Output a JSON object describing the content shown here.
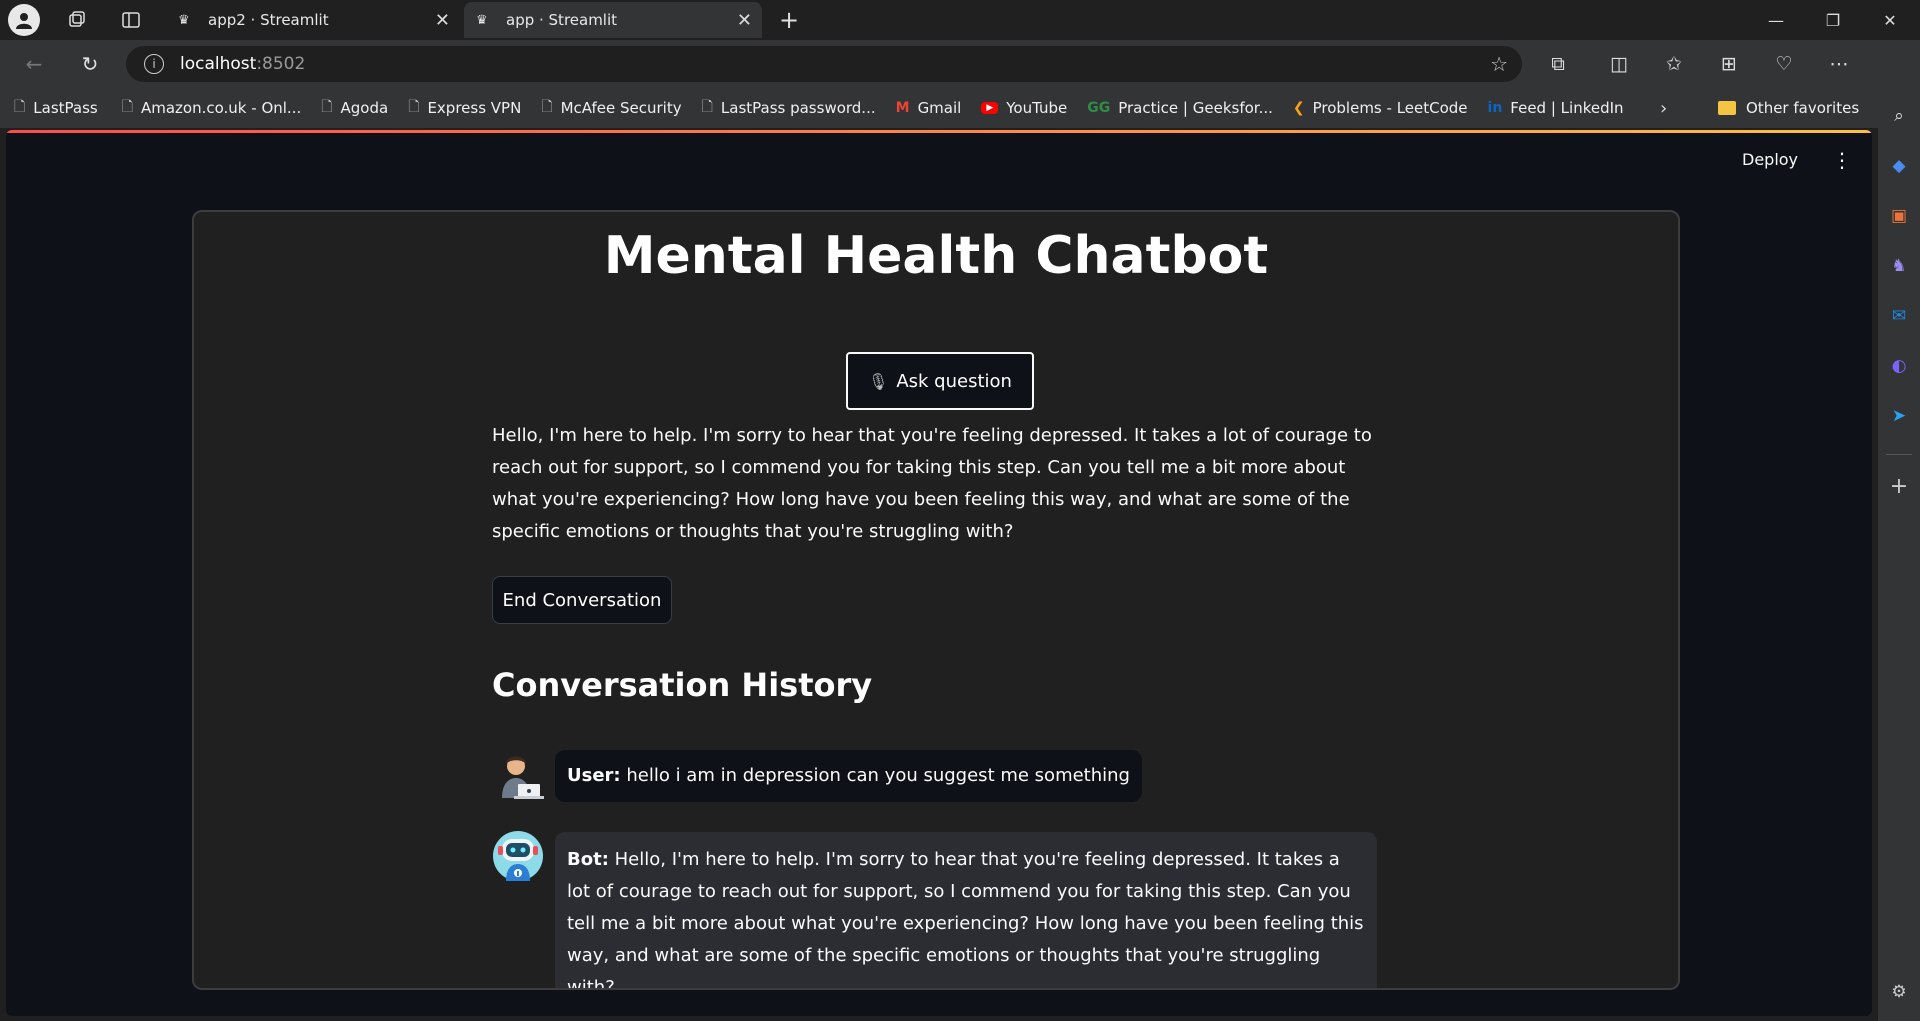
{
  "browser": {
    "tabs": [
      {
        "title": "app2 · Streamlit",
        "active": false
      },
      {
        "title": "app · Streamlit",
        "active": true
      }
    ],
    "url_host": "localhost",
    "url_port": ":8502",
    "bookmarks": [
      {
        "label": "LastPass",
        "icon": "page-icon"
      },
      {
        "label": "Amazon.co.uk - Onl...",
        "icon": "page-icon"
      },
      {
        "label": "Agoda",
        "icon": "page-icon"
      },
      {
        "label": "Express VPN",
        "icon": "page-icon"
      },
      {
        "label": "McAfee Security",
        "icon": "page-icon"
      },
      {
        "label": "LastPass password...",
        "icon": "page-icon"
      },
      {
        "label": "Gmail",
        "icon": "gmail-icon"
      },
      {
        "label": "YouTube",
        "icon": "youtube-icon"
      },
      {
        "label": "Practice | Geeksfor...",
        "icon": "gfg-icon"
      },
      {
        "label": "Problems - LeetCode",
        "icon": "leetcode-icon"
      },
      {
        "label": "Feed | LinkedIn",
        "icon": "linkedin-icon"
      }
    ],
    "other_favorites": "Other favorites"
  },
  "app": {
    "deploy_label": "Deploy",
    "title": "Mental Health Chatbot",
    "ask_button": "Ask question",
    "reply": "Hello, I'm here to help. I'm sorry to hear that you're feeling depressed. It takes a lot of courage to reach out for support, so I commend you for taking this step. Can you tell me a bit more about what you're experiencing? How long have you been feeling this way, and what are some of the specific emotions or thoughts that you're struggling with?",
    "end_button": "End Conversation",
    "history_title": "Conversation History",
    "history": [
      {
        "speaker": "User:",
        "text": "hello i am in depression can you suggest me something"
      },
      {
        "speaker": "Bot:",
        "text": "Hello, I'm here to help. I'm sorry to hear that you're feeling depressed. It takes a lot of courage to reach out for support, so I commend you for taking this step. Can you tell me a bit more about what you're experiencing? How long have you been feeling this way, and what are some of the specific emotions or thoughts that you're struggling with?"
      }
    ]
  },
  "colors": {
    "background": "#0e1117",
    "card": "#202020",
    "bot_bubble": "#2b2d33",
    "accent_gradient_start": "#ff4b4b",
    "accent_gradient_end": "#ffbd45"
  }
}
